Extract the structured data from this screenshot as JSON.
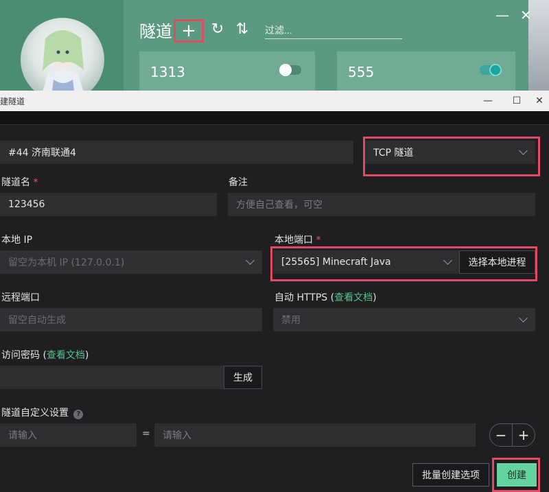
{
  "app": {
    "title": "隧道",
    "filter_placeholder": "过滤...",
    "tunnels": [
      {
        "name": "1313",
        "enabled": false
      },
      {
        "name": "555",
        "enabled": true
      }
    ],
    "icons": {
      "add": "+",
      "refresh": "↻",
      "sort": "⇅",
      "minimize": "—",
      "close": "✕"
    }
  },
  "dialog": {
    "title": "建隧道",
    "window_buttons": {
      "minimize": "—",
      "maximize": "☐",
      "close": "✕"
    },
    "node_value": "#44 济南联通4",
    "type_value": "TCP 隧道",
    "tunnel_name_label": "隧道名",
    "required_mark": "*",
    "tunnel_name_value": "123456",
    "remark_label": "备注",
    "remark_placeholder": "方便自己查看，可空",
    "local_ip_label": "本地 IP",
    "local_ip_placeholder": "留空为本机 IP (127.0.0.1)",
    "local_port_label": "本地端口",
    "local_port_value": "[25565] Minecraft Java",
    "select_process_label": "选择本地进程",
    "remote_port_label": "远程端口",
    "remote_port_placeholder": "留空自动生成",
    "auto_https_label": "自动 HTTPS",
    "view_docs": "查看文档",
    "paren_open": "(",
    "paren_close": ")",
    "auto_https_value": "禁用",
    "access_key_label": "访问密码",
    "generate_label": "生成",
    "custom_settings_label": "隧道自定义设置",
    "help_icon": "?",
    "kv_key_placeholder": "请输入",
    "kv_equals": "=",
    "kv_value_placeholder": "请输入",
    "minus_label": "−",
    "plus_label": "+",
    "batch_create_label": "批量创建选项",
    "create_label": "创建"
  },
  "colors": {
    "accent": "#5b9a80",
    "highlight": "#e14b5f",
    "primary_button": "#63d3a0",
    "link": "#55c28e"
  }
}
